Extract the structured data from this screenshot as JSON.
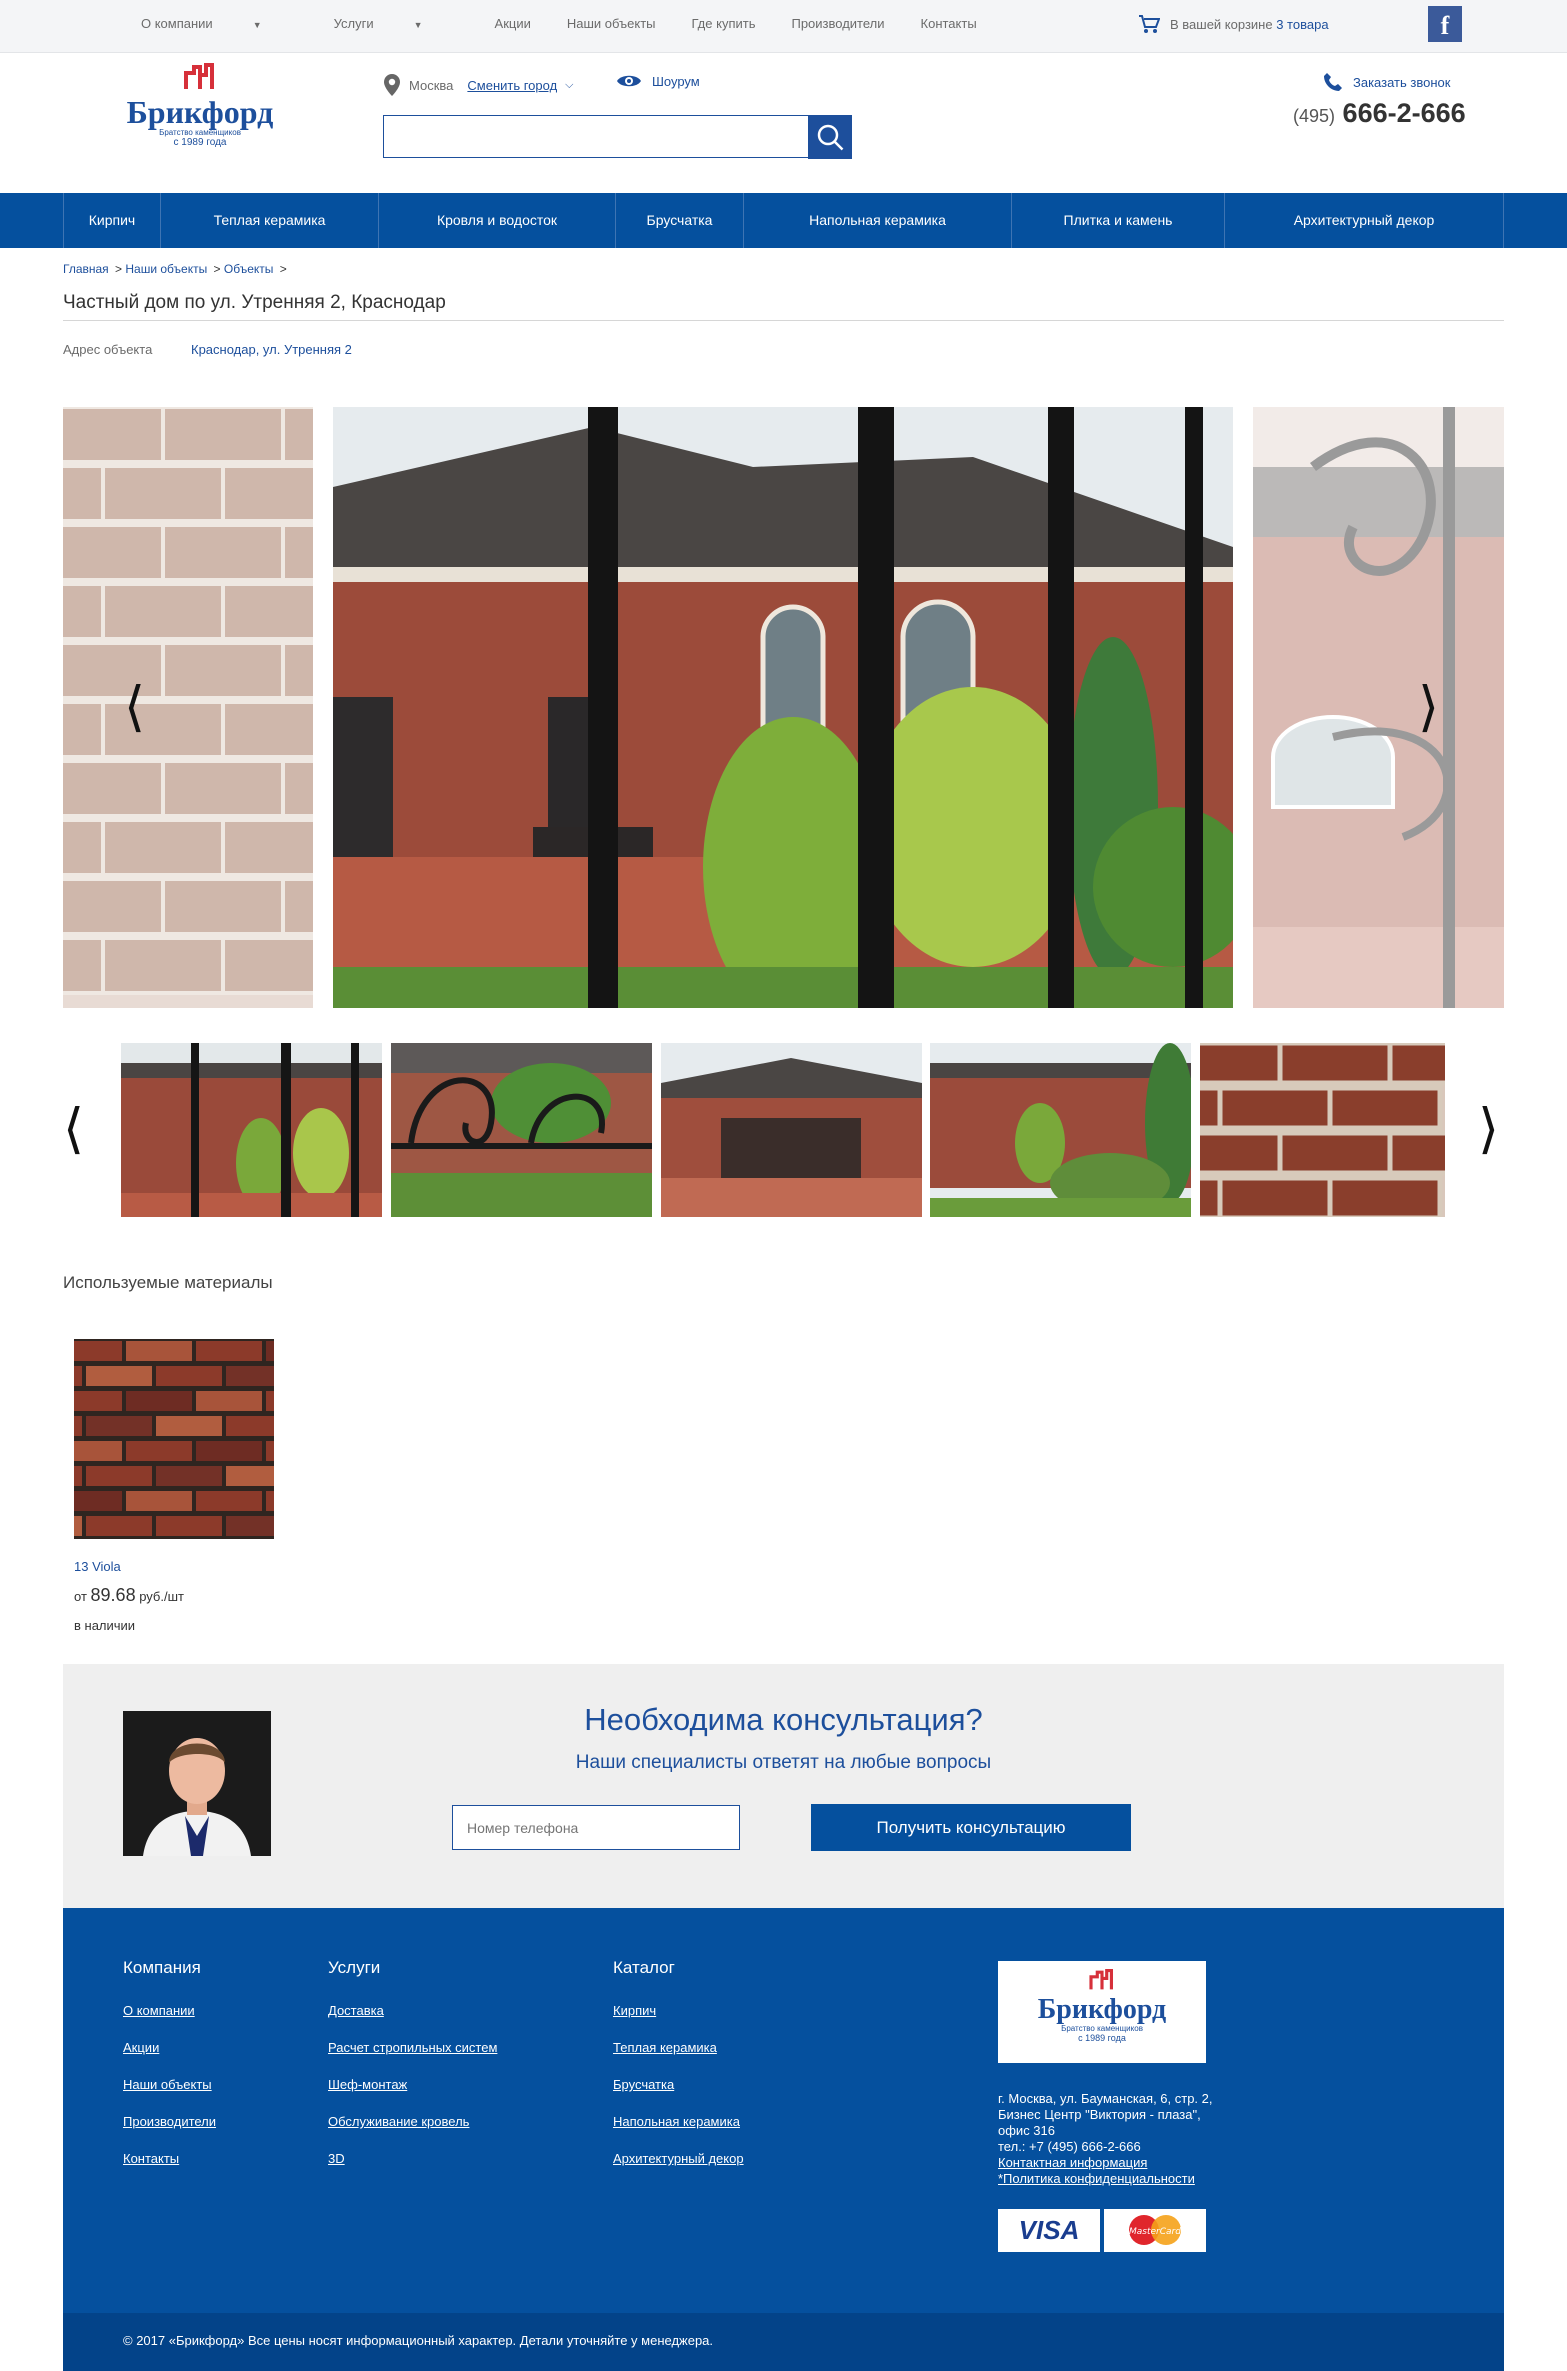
{
  "topnav": {
    "items": [
      "О компании",
      "Услуги",
      "Акции",
      "Наши объекты",
      "Где купить",
      "Производители",
      "Контакты"
    ],
    "cart_text": "В вашей корзине",
    "cart_count": "3 товара",
    "fb_label": "f"
  },
  "header": {
    "logo_name": "Брикфорд",
    "logo_tag": "Братство каменщиков",
    "logo_year": "с 1989 года",
    "city": "Москва",
    "change_city": "Сменить город",
    "showroom": "Шоурум",
    "search_placeholder": "",
    "callback": "Заказать звонок",
    "phone_code": "(495)",
    "phone_number": "666-2-666"
  },
  "catnav": [
    "Кирпич",
    "Теплая керамика",
    "Кровля и водосток",
    "Брусчатка",
    "Напольная керамика",
    "Плитка и камень",
    "Архитектурный декор"
  ],
  "breadcrumb": [
    "Главная",
    "Наши объекты",
    "Объекты"
  ],
  "page": {
    "title": "Частный дом по ул. Утренняя 2, Краснодар",
    "address_label": "Адрес объекта",
    "address_value": "Краснодар, ул. Утренняя 2"
  },
  "gallery": {
    "prev": "⟨",
    "next": "⟩"
  },
  "materials": {
    "heading": "Используемые материалы",
    "items": [
      {
        "name": "13 Viola",
        "price_prefix": "от",
        "price": "89.68",
        "unit": "руб./шт",
        "stock": "в наличии"
      }
    ]
  },
  "consult": {
    "title": "Необходима консультация?",
    "subtitle": "Наши специалисты ответят на любые вопросы",
    "phone_placeholder": "Номер телефона",
    "button": "Получить консультацию"
  },
  "footer": {
    "col1": {
      "title": "Компания",
      "links": [
        "О компании",
        "Акции",
        "Наши объекты",
        "Производители",
        "Контакты"
      ]
    },
    "col2": {
      "title": "Услуги",
      "links": [
        "Доставка",
        "Расчет стропильных систем",
        "Шеф-монтаж",
        "Обслуживание кровель",
        "3D"
      ]
    },
    "col3": {
      "title": "Каталог",
      "links": [
        "Кирпич",
        "Теплая керамика",
        "Брусчатка",
        "Напольная керамика",
        "Архитектурный декор"
      ]
    },
    "address": "г. Москва, ул. Бауманская, 6, стр. 2, Бизнес Центр \"Виктория - плаза\", офис 316",
    "tel": "тел.: +7 (495) 666-2-666",
    "contacts_link": "Контактная информация",
    "policy_link": "*Политика конфиденциальности",
    "visa": "VISA",
    "mastercard": "MasterCard",
    "copyright": "© 2017 «Брикфорд»    Все цены носят информационный характер. Детали уточняйте у менеджера."
  },
  "colors": {
    "brand_blue": "#05509e",
    "link_blue": "#1d4f9c",
    "logo_red": "#d6303a"
  }
}
